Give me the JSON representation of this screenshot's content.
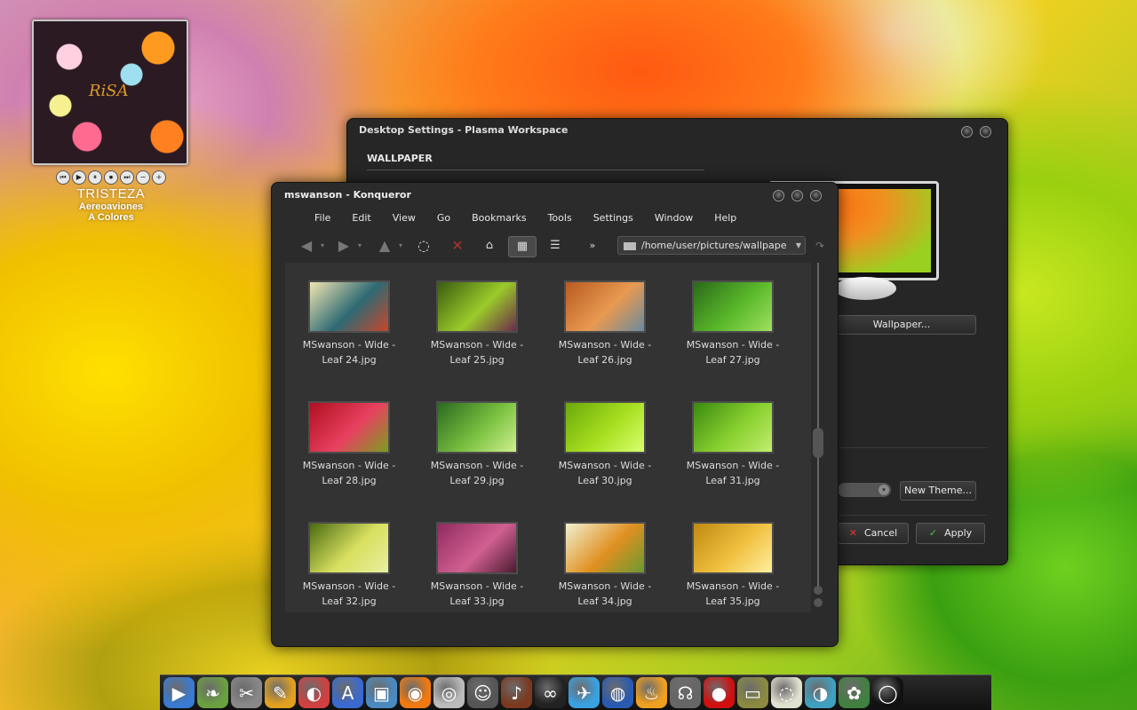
{
  "player": {
    "cover_text": "RiSA",
    "controls": [
      "⏮",
      "▶",
      "⏸",
      "⏹",
      "⏭",
      "−",
      "+"
    ],
    "title": "TRISTEZA",
    "artist": "Aereoaviones",
    "album": "A Colores"
  },
  "settings_window": {
    "title": "Desktop Settings - Plasma Workspace",
    "section": "WALLPAPER",
    "wallpaper_button": "Wallpaper...",
    "new_theme_button": "New Theme...",
    "cancel_button": "Cancel",
    "apply_button": "Apply"
  },
  "konqueror": {
    "title": "mswanson - Konqueror",
    "menu": [
      "File",
      "Edit",
      "View",
      "Go",
      "Bookmarks",
      "Tools",
      "Settings",
      "Window",
      "Help"
    ],
    "location": "/home/user/pictures/wallpape",
    "files": [
      {
        "line1": "MSwanson - Wide -",
        "line2": "Leaf 24.jpg",
        "colors": [
          "#f2e6b0",
          "#2e6a74",
          "#c8462a"
        ]
      },
      {
        "line1": "MSwanson - Wide -",
        "line2": "Leaf 25.jpg",
        "colors": [
          "#3a5c10",
          "#9acb2a",
          "#6a2a4a"
        ]
      },
      {
        "line1": "MSwanson - Wide -",
        "line2": "Leaf 26.jpg",
        "colors": [
          "#b85a20",
          "#e89a50",
          "#6a8aa0"
        ]
      },
      {
        "line1": "MSwanson - Wide -",
        "line2": "Leaf 27.jpg",
        "colors": [
          "#2a6a1a",
          "#5ab82a",
          "#a0e060"
        ]
      },
      {
        "line1": "MSwanson - Wide -",
        "line2": "Leaf 28.jpg",
        "colors": [
          "#b01020",
          "#e84060",
          "#7aa020"
        ]
      },
      {
        "line1": "MSwanson - Wide -",
        "line2": "Leaf 29.jpg",
        "colors": [
          "#2a6a20",
          "#7ac040",
          "#d0f090"
        ]
      },
      {
        "line1": "MSwanson - Wide -",
        "line2": "Leaf 30.jpg",
        "colors": [
          "#6aa80a",
          "#a8e020",
          "#d8ff70"
        ]
      },
      {
        "line1": "MSwanson - Wide -",
        "line2": "Leaf 31.jpg",
        "colors": [
          "#3a8a10",
          "#8ad030",
          "#c0ee70"
        ]
      },
      {
        "line1": "MSwanson - Wide -",
        "line2": "Leaf 32.jpg",
        "colors": [
          "#4a6a10",
          "#d8e060",
          "#e8f0a0"
        ]
      },
      {
        "line1": "MSwanson - Wide -",
        "line2": "Leaf 33.jpg",
        "colors": [
          "#902a60",
          "#d06090",
          "#4a1a30"
        ]
      },
      {
        "line1": "MSwanson - Wide -",
        "line2": "Leaf 34.jpg",
        "colors": [
          "#f0f0d0",
          "#e09020",
          "#6a9a30"
        ]
      },
      {
        "line1": "MSwanson - Wide -",
        "line2": "Leaf 35.jpg",
        "colors": [
          "#c08a10",
          "#f0c040",
          "#fff0a0"
        ]
      }
    ]
  },
  "dock": {
    "icons": [
      {
        "name": "media-player-icon",
        "glyph": "▶",
        "color": "#3a7ad0"
      },
      {
        "name": "leaf-icon",
        "glyph": "❧",
        "color": "#6aa040"
      },
      {
        "name": "tools-icon",
        "glyph": "✂",
        "color": "#888888"
      },
      {
        "name": "paint-icon",
        "glyph": "✎",
        "color": "#e0a020"
      },
      {
        "name": "palette-icon",
        "glyph": "◐",
        "color": "#d04040"
      },
      {
        "name": "app-store-icon",
        "glyph": "A",
        "color": "#3a6ad0"
      },
      {
        "name": "photos-icon",
        "glyph": "▣",
        "color": "#4a8ac0"
      },
      {
        "name": "rss-icon",
        "glyph": "◉",
        "color": "#f07a10"
      },
      {
        "name": "cd-icon",
        "glyph": "◎",
        "color": "#bbbbbb"
      },
      {
        "name": "tux-icon",
        "glyph": "☺",
        "color": "#555555"
      },
      {
        "name": "guitar-icon",
        "glyph": "♪",
        "color": "#7a3a20"
      },
      {
        "name": "lastfm-icon",
        "glyph": "∞",
        "color": "#222222"
      },
      {
        "name": "bird-icon",
        "glyph": "✈",
        "color": "#3aa0e0"
      },
      {
        "name": "globe-icon",
        "glyph": "◍",
        "color": "#2a5ab0"
      },
      {
        "name": "flame-icon",
        "glyph": "♨",
        "color": "#f0a020"
      },
      {
        "name": "headphones-icon",
        "glyph": "☊",
        "color": "#666666"
      },
      {
        "name": "record-icon",
        "glyph": "●",
        "color": "#d01010"
      },
      {
        "name": "monitor-icon",
        "glyph": "▭",
        "color": "#8a8a40"
      },
      {
        "name": "dish-icon",
        "glyph": "◌",
        "color": "#e0e0d0"
      },
      {
        "name": "earth-icon",
        "glyph": "◑",
        "color": "#40a0c0"
      },
      {
        "name": "flower-icon",
        "glyph": "✿",
        "color": "#408040"
      },
      {
        "name": "bowl-icon",
        "glyph": "◯",
        "color": "#111111"
      }
    ]
  }
}
